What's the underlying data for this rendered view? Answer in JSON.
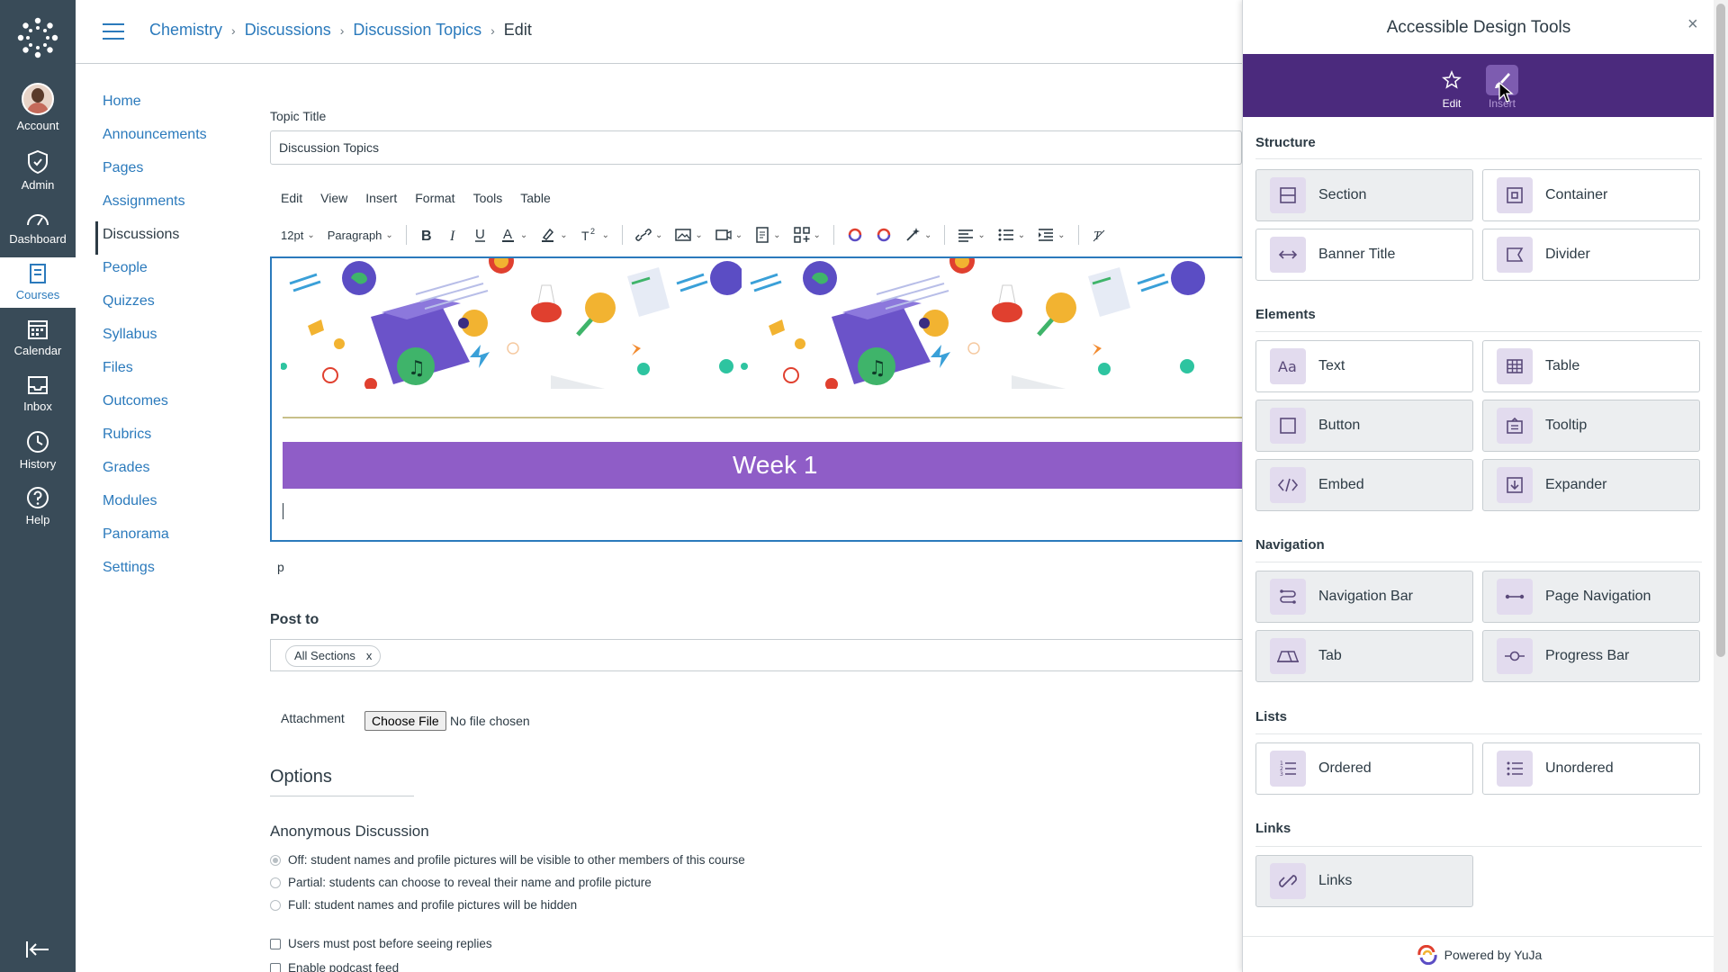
{
  "global_nav": {
    "items": [
      {
        "label": "Account",
        "icon": "avatar"
      },
      {
        "label": "Admin",
        "icon": "shield-icon"
      },
      {
        "label": "Dashboard",
        "icon": "dashboard-icon"
      },
      {
        "label": "Courses",
        "icon": "book-icon"
      },
      {
        "label": "Calendar",
        "icon": "calendar-icon"
      },
      {
        "label": "Inbox",
        "icon": "inbox-icon"
      },
      {
        "label": "History",
        "icon": "clock-icon"
      },
      {
        "label": "Help",
        "icon": "help-icon"
      }
    ],
    "active": "Courses"
  },
  "breadcrumb": [
    "Chemistry",
    "Discussions",
    "Discussion Topics",
    "Edit"
  ],
  "course_nav": [
    "Home",
    "Announcements",
    "Pages",
    "Assignments",
    "Discussions",
    "People",
    "Quizzes",
    "Syllabus",
    "Files",
    "Outcomes",
    "Rubrics",
    "Grades",
    "Modules",
    "Panorama",
    "Settings"
  ],
  "course_nav_active": "Discussions",
  "form": {
    "topic_title_label": "Topic Title",
    "topic_title_value": "Discussion Topics",
    "menubar": [
      "Edit",
      "View",
      "Insert",
      "Format",
      "Tools",
      "Table"
    ],
    "font_size": "12pt",
    "block_format": "Paragraph",
    "week_banner": "Week 1",
    "status_path": "p",
    "post_to_label": "Post to",
    "post_to_chip": "All Sections",
    "chip_remove": "x",
    "attachment_label": "Attachment",
    "choose_file": "Choose File",
    "no_file": "No file chosen",
    "options_title": "Options",
    "anonymous_title": "Anonymous Discussion",
    "anon_off": "Off: student names and profile pictures will be visible to other members of this course",
    "anon_partial": "Partial: students can choose to reveal their name and profile picture",
    "anon_full": "Full: student names and profile pictures will be hidden",
    "must_post": "Users must post before seeing replies",
    "podcast": "Enable podcast feed"
  },
  "panel": {
    "title": "Accessible Design Tools",
    "close": "×",
    "tabs": [
      {
        "label": "Edit"
      },
      {
        "label": "Insert"
      }
    ],
    "selected_tab": "Insert",
    "sections": {
      "structure": "Structure",
      "elements": "Elements",
      "navigation": "Navigation",
      "lists": "Lists",
      "links": "Links"
    },
    "tiles": {
      "section": "Section",
      "container": "Container",
      "banner_title": "Banner Title",
      "divider": "Divider",
      "text": "Text",
      "table": "Table",
      "button": "Button",
      "tooltip": "Tooltip",
      "embed": "Embed",
      "expander": "Expander",
      "navigation_bar": "Navigation Bar",
      "page_navigation": "Page Navigation",
      "tab": "Tab",
      "progress_bar": "Progress Bar",
      "ordered": "Ordered",
      "unordered": "Unordered",
      "links": "Links"
    },
    "footer": "Powered by YuJa"
  },
  "colors": {
    "nav_bg": "#394b58",
    "link": "#2b7abc",
    "banner_purple": "#8f5dc7",
    "panel_header": "#4b2a7d"
  }
}
